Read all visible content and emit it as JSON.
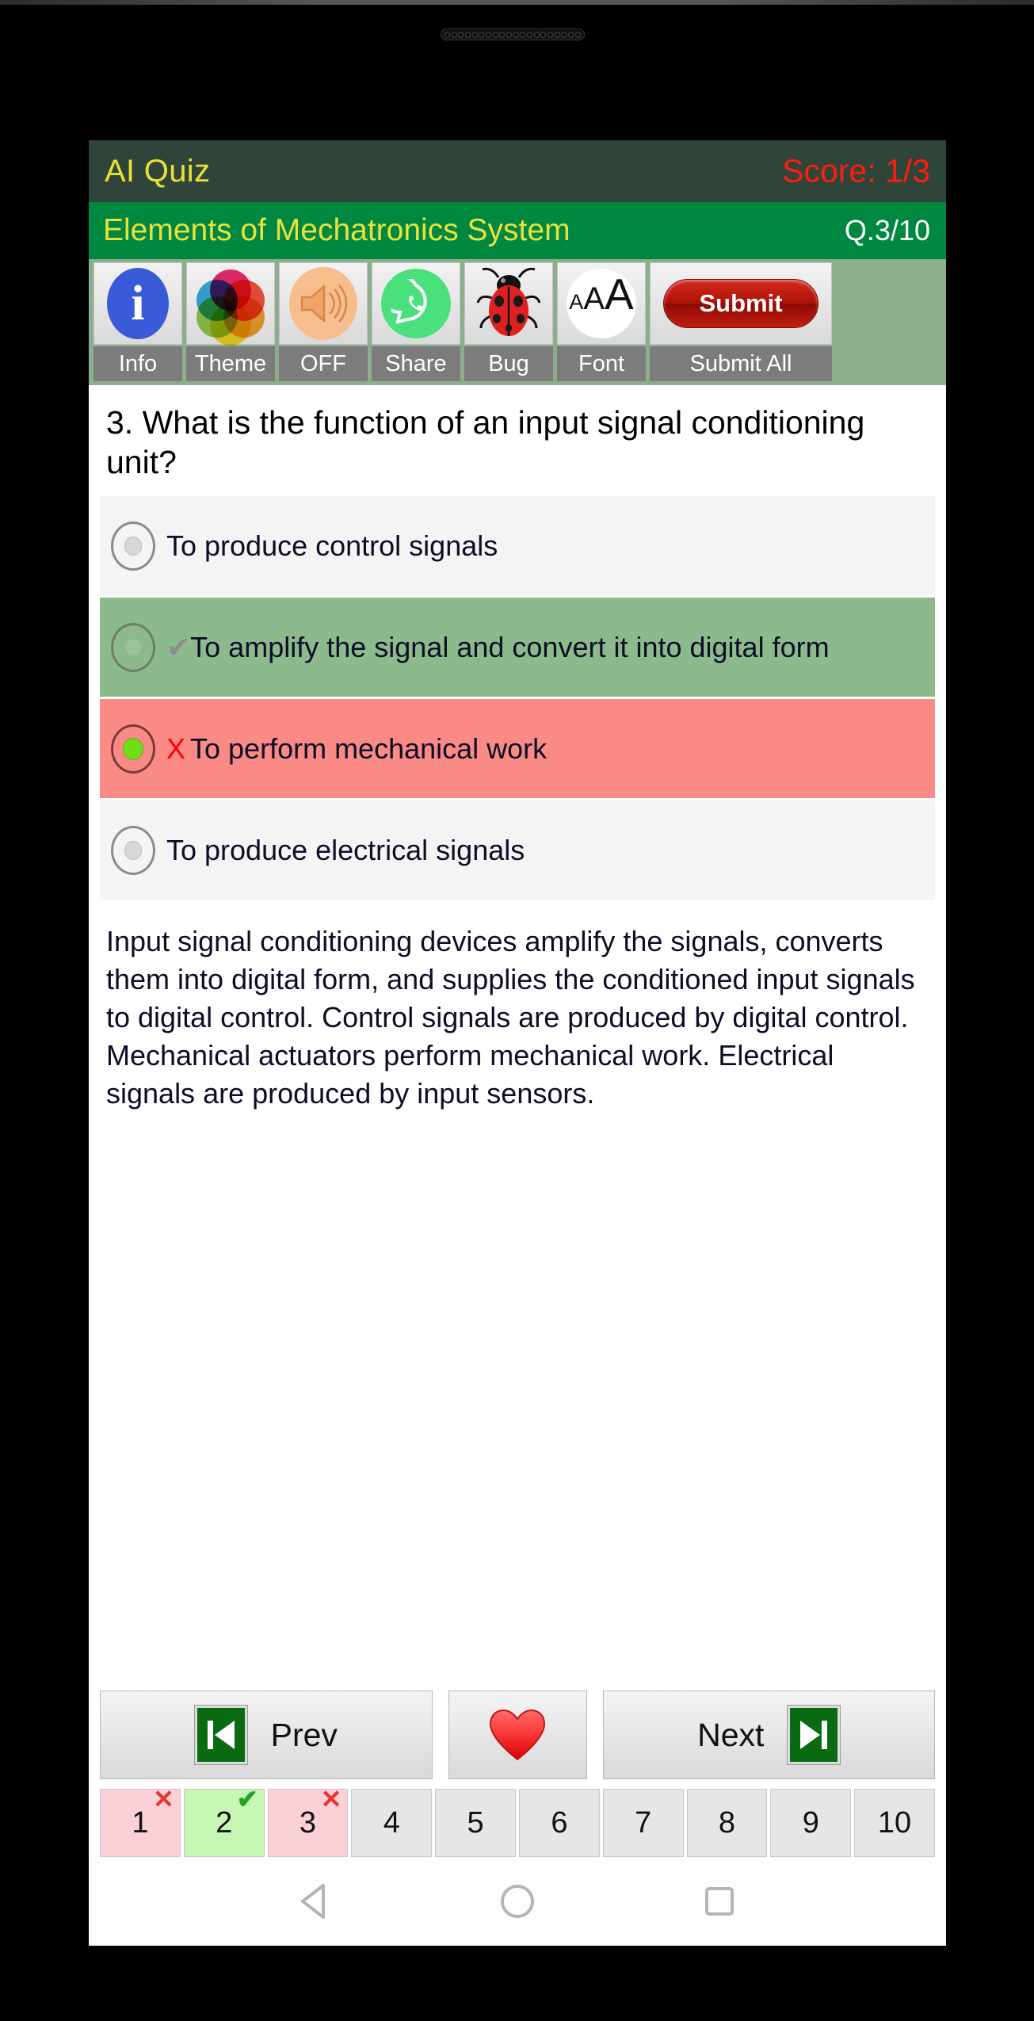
{
  "app": {
    "title": "AI Quiz",
    "score": "Score: 1/3",
    "subject": "Elements of Mechatronics System",
    "question_counter": "Q.3/10",
    "accent_green": "#008740",
    "header_green": "#2f4539",
    "title_yellow": "#e8e035",
    "score_red": "#ff1b0e"
  },
  "toolbar": {
    "items": [
      {
        "label": "Info",
        "icon": "info-icon"
      },
      {
        "label": "Theme",
        "icon": "color-wheel-icon"
      },
      {
        "label": "OFF",
        "icon": "speaker-icon"
      },
      {
        "label": "Share",
        "icon": "whatsapp-icon"
      },
      {
        "label": "Bug",
        "icon": "ladybug-icon"
      },
      {
        "label": "Font",
        "icon": "font-size-icon"
      }
    ],
    "submit_label": "Submit",
    "submit_all_label": "Submit All"
  },
  "question": {
    "text": "3. What is the function of an input signal conditioning unit?",
    "options": [
      {
        "text": "To produce control signals",
        "state": "neutral",
        "mark": "",
        "selected": false
      },
      {
        "text": "To amplify the signal and convert it into digital form",
        "state": "correct",
        "mark": "✔",
        "selected": false
      },
      {
        "text": "To perform mechanical work",
        "state": "wrong",
        "mark": "X",
        "selected": true
      },
      {
        "text": "To produce electrical signals",
        "state": "neutral",
        "mark": "",
        "selected": false
      }
    ],
    "explanation": "Input signal conditioning devices amplify the signals, converts them into digital form, and supplies the conditioned input signals to digital control. Control signals are produced by digital control. Mechanical actuators perform mechanical work. Electrical signals are produced by input sensors."
  },
  "navigation": {
    "prev_label": "Prev",
    "next_label": "Next",
    "favorite_icon": "heart-icon"
  },
  "question_numbers": [
    {
      "n": "1",
      "state": "incorrect",
      "badge": "✕"
    },
    {
      "n": "2",
      "state": "correct",
      "badge": "✔"
    },
    {
      "n": "3",
      "state": "incorrect",
      "badge": "✕"
    },
    {
      "n": "4",
      "state": "unanswered",
      "badge": ""
    },
    {
      "n": "5",
      "state": "unanswered",
      "badge": ""
    },
    {
      "n": "6",
      "state": "unanswered",
      "badge": ""
    },
    {
      "n": "7",
      "state": "unanswered",
      "badge": ""
    },
    {
      "n": "8",
      "state": "unanswered",
      "badge": ""
    },
    {
      "n": "9",
      "state": "unanswered",
      "badge": ""
    },
    {
      "n": "10",
      "state": "unanswered",
      "badge": ""
    }
  ],
  "android_nav": {
    "back": "back-icon",
    "home": "home-icon",
    "recents": "recents-icon"
  }
}
